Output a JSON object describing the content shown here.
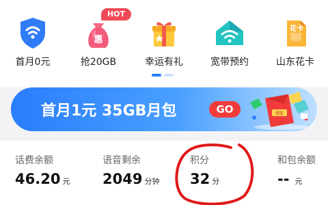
{
  "menu": {
    "items": [
      {
        "label": "首月0元",
        "icon": "shield-wifi-icon"
      },
      {
        "label": "抢20GB",
        "icon": "money-bag-icon"
      },
      {
        "label": "幸运有礼",
        "icon": "gift-box-icon"
      },
      {
        "label": "宽带预约",
        "icon": "router-wifi-icon"
      },
      {
        "label": "山东花卡",
        "icon": "sim-card-icon"
      }
    ],
    "hot_badge": "HOT",
    "bag_glyph": "惠",
    "card_glyph": "花卡"
  },
  "banner": {
    "text": "首月1元  35GB月包",
    "go_label": "GO",
    "gift_label": "颁奖"
  },
  "stats": [
    {
      "label": "话费余额",
      "value": "46.20",
      "unit": "元"
    },
    {
      "label": "语音剩余",
      "value": "2049",
      "unit": "分钟"
    },
    {
      "label": "积分",
      "value": "32",
      "unit": "分"
    },
    {
      "label": "和包余额",
      "value": "--",
      "unit": "元"
    }
  ],
  "colors": {
    "accent_blue": "#2a7dfc",
    "hot_red": "#f04a57",
    "annotation_red": "#e01818"
  }
}
